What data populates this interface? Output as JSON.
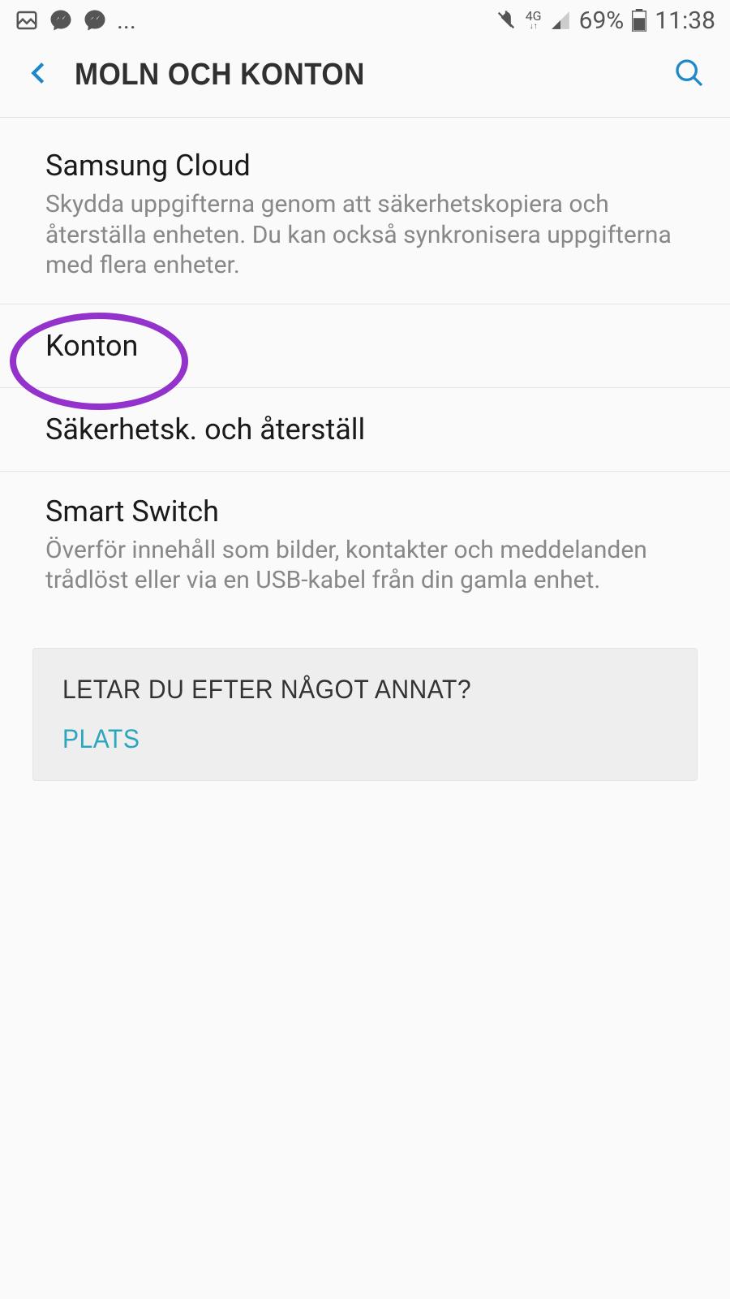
{
  "statusBar": {
    "network": "4G",
    "battery": "69%",
    "time": "11:38",
    "more": "..."
  },
  "header": {
    "title": "MOLN OCH KONTON"
  },
  "items": [
    {
      "title": "Samsung Cloud",
      "desc": "Skydda uppgifterna genom att säkerhetskopiera och återställa enheten. Du kan också synkronisera uppgifterna med flera enheter."
    },
    {
      "title": "Konton",
      "desc": ""
    },
    {
      "title": "Säkerhetsk. och återställ",
      "desc": ""
    },
    {
      "title": "Smart Switch",
      "desc": "Överför innehåll som bilder, kontakter och meddelanden trådlöst eller via en USB-kabel från din gamla enhet."
    }
  ],
  "footer": {
    "title": "LETAR DU EFTER NÅGOT ANNAT?",
    "link": "PLATS"
  }
}
